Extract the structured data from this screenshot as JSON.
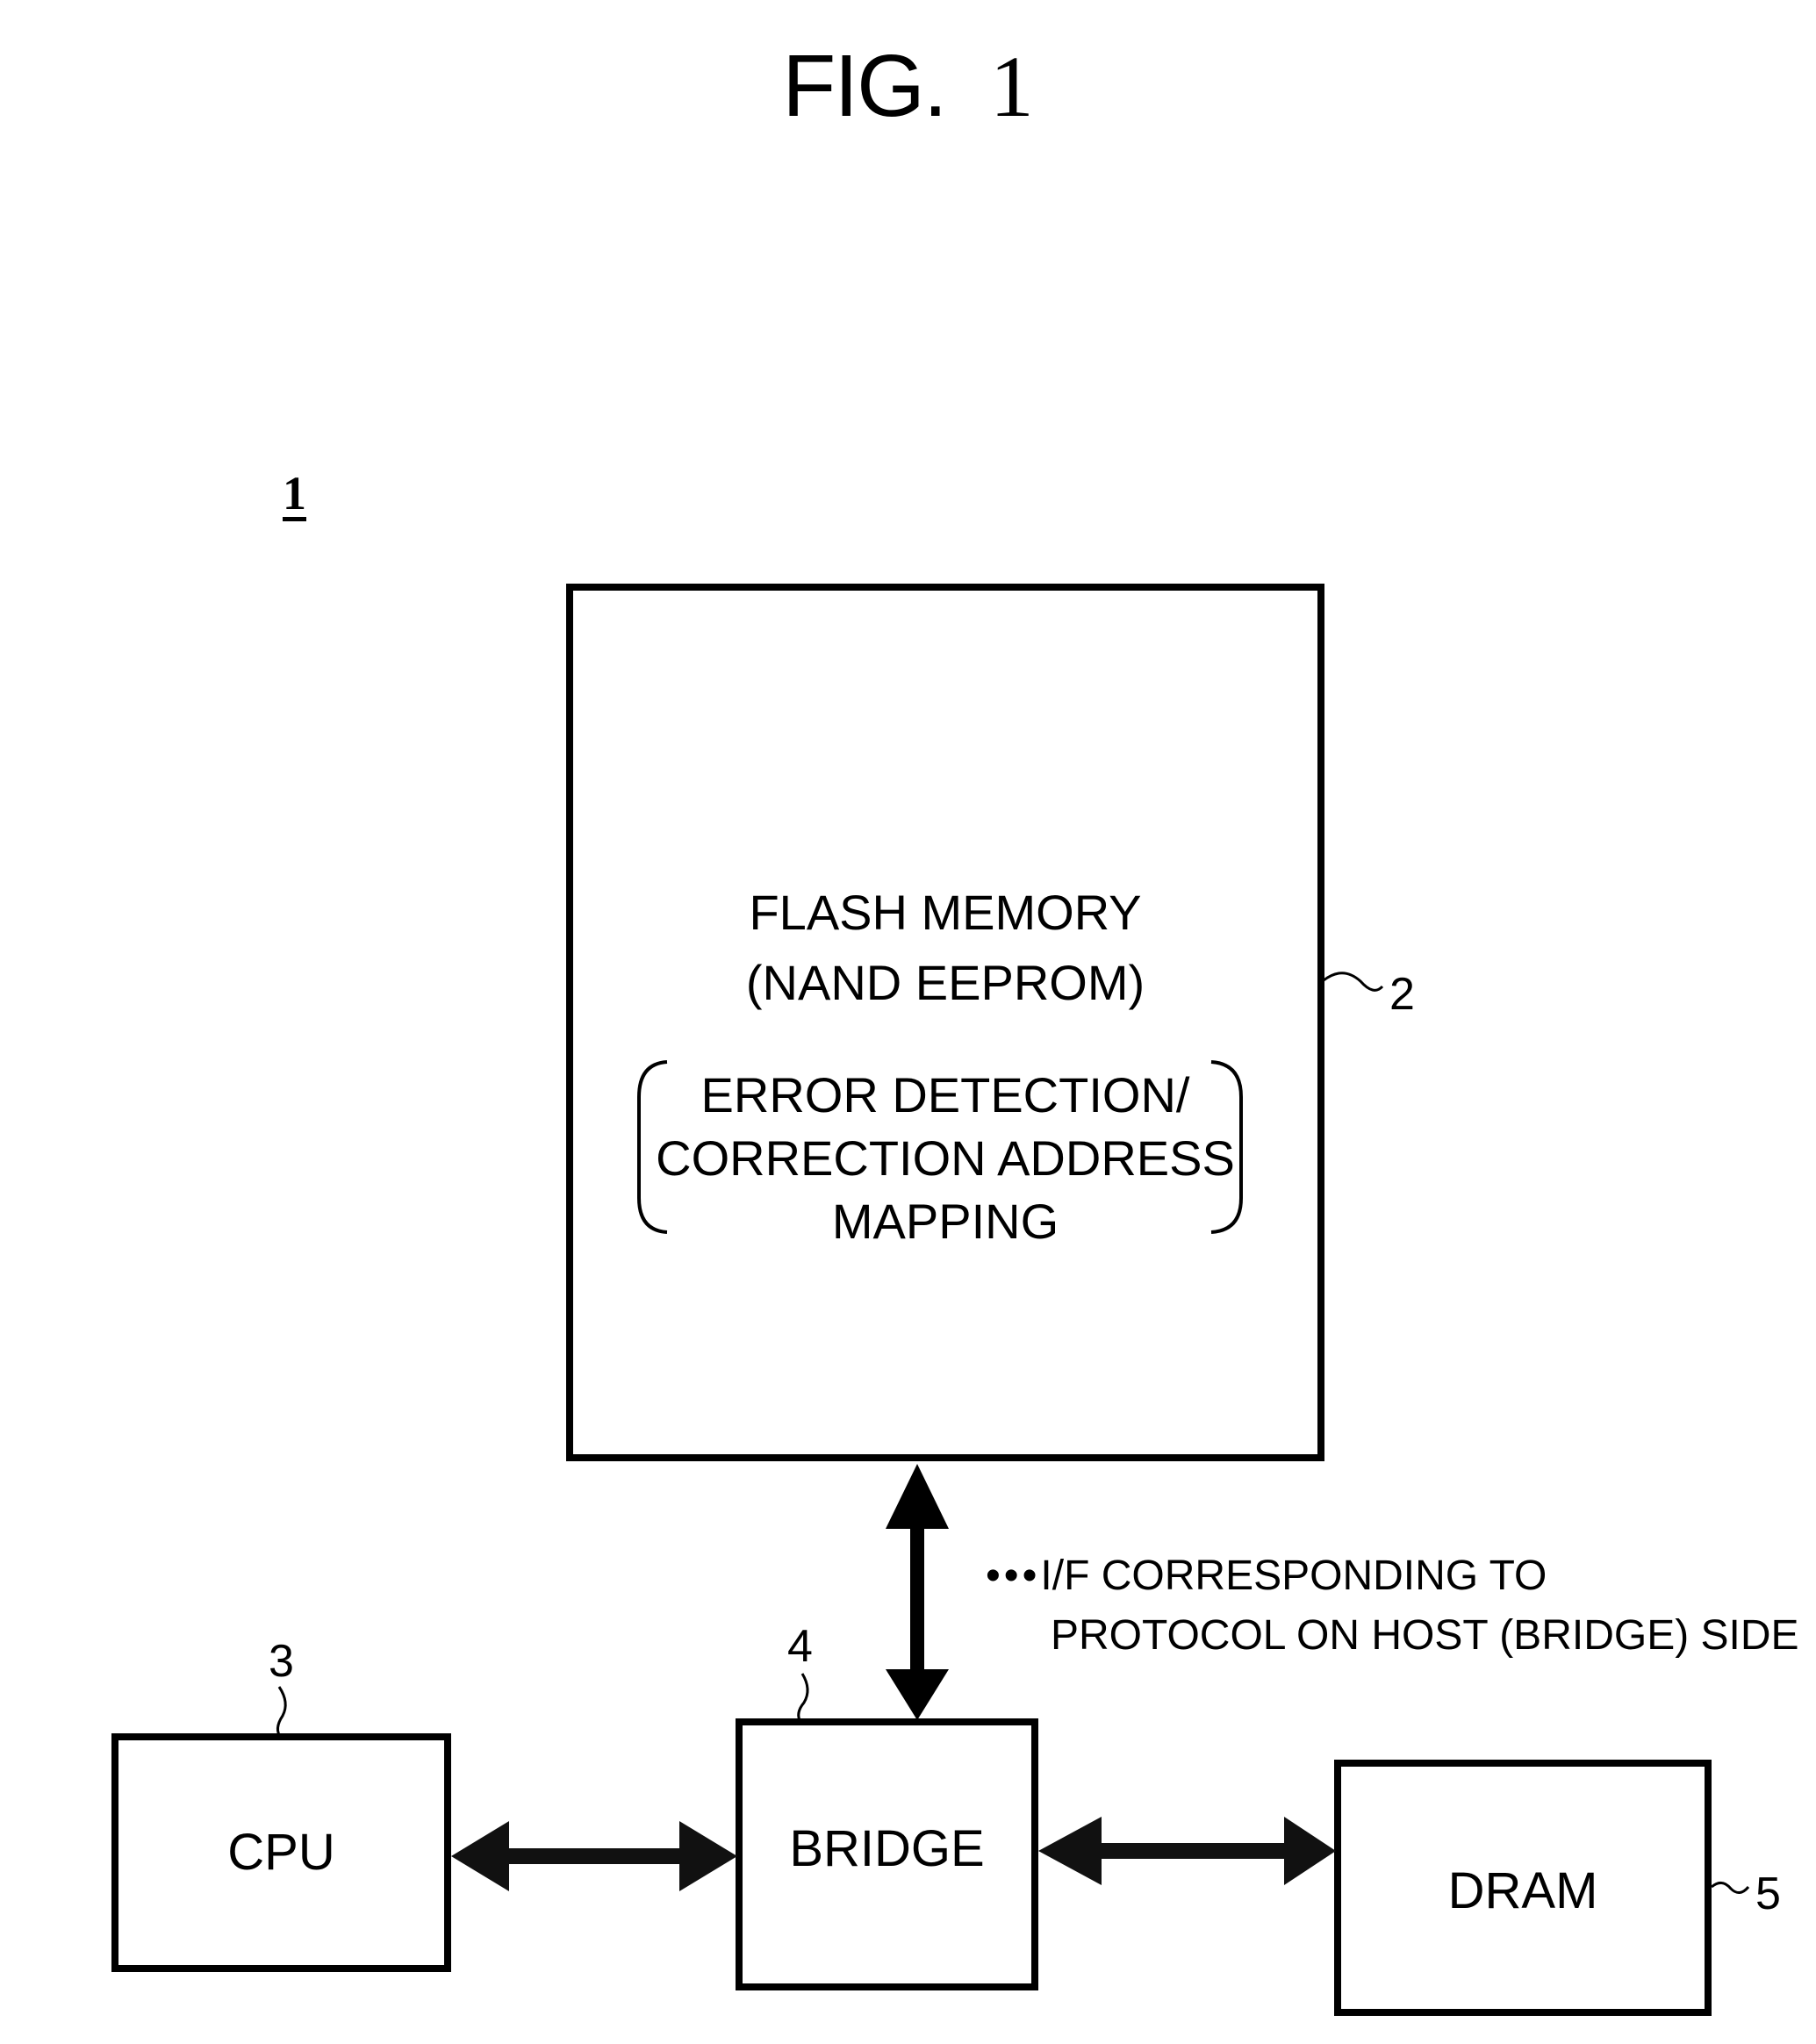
{
  "figure": {
    "title": "FIG.",
    "number": "1",
    "system_ref": "1"
  },
  "blocks": {
    "flash": {
      "line1": "FLASH MEMORY",
      "line2": "(NAND EEPROM)",
      "sub1": "ERROR DETECTION/",
      "sub2": "CORRECTION ADDRESS",
      "sub3": "MAPPING",
      "ref": "2"
    },
    "cpu": {
      "label": "CPU",
      "ref": "3"
    },
    "bridge": {
      "label": "BRIDGE",
      "ref": "4"
    },
    "dram": {
      "label": "DRAM",
      "ref": "5"
    }
  },
  "annotation": {
    "prefix": "•••",
    "line1": "I/F CORRESPONDING TO",
    "line2": "PROTOCOL ON HOST (BRIDGE) SIDE"
  },
  "connections": [
    {
      "from": "flash",
      "to": "bridge",
      "type": "bidirectional"
    },
    {
      "from": "cpu",
      "to": "bridge",
      "type": "bidirectional"
    },
    {
      "from": "bridge",
      "to": "dram",
      "type": "bidirectional"
    }
  ]
}
